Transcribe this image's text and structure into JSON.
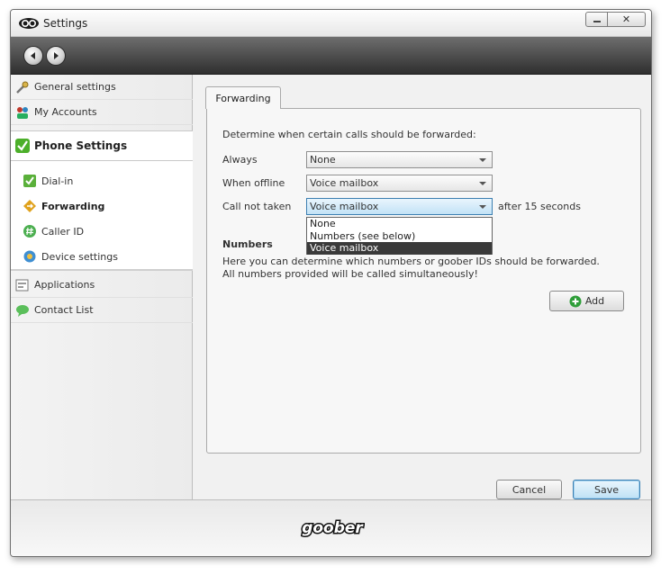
{
  "window": {
    "title": "Settings",
    "controls": {
      "minimize": "▭",
      "close": "✕"
    }
  },
  "nav": {
    "back_icon": "back-arrow-icon",
    "forward_icon": "forward-arrow-icon"
  },
  "sidebar": {
    "items": [
      {
        "label": "General settings",
        "icon": "wrench-icon"
      },
      {
        "label": "My Accounts",
        "icon": "accounts-icon"
      },
      {
        "label": "Phone Settings",
        "icon": "checkmark-icon"
      },
      {
        "label": "Applications",
        "icon": "applications-icon"
      },
      {
        "label": "Contact List",
        "icon": "contact-bubble-icon"
      }
    ],
    "subitems": [
      {
        "label": "Dial-in",
        "icon": "check-icon"
      },
      {
        "label": "Forwarding",
        "icon": "forwarding-icon"
      },
      {
        "label": "Caller ID",
        "icon": "hash-icon"
      },
      {
        "label": "Device settings",
        "icon": "device-icon"
      }
    ]
  },
  "tab": {
    "label": "Forwarding"
  },
  "form": {
    "intro": "Determine when certain calls should be forwarded:",
    "always_label": "Always",
    "always_value": "None",
    "offline_label": "When offline",
    "offline_value": "Voice mailbox",
    "not_taken_label": "Call not taken",
    "not_taken_value": "Voice mailbox",
    "after_text": "after 15 seconds",
    "dropdown_options": [
      "None",
      "Numbers (see below)",
      "Voice mailbox"
    ],
    "numbers_heading": "Numbers",
    "numbers_desc_1": "Here you can determine which numbers or goober IDs should be forwarded.",
    "numbers_desc_2": "All numbers provided will be called simultaneously!",
    "add_label": "Add"
  },
  "buttons": {
    "cancel": "Cancel",
    "save": "Save"
  },
  "footer": {
    "logo_text": "goober"
  },
  "colors": {
    "accent": "#3c7fb1",
    "navbar_dark": "#2f2f2f",
    "dropdown_selected": "#3a3a3a"
  }
}
